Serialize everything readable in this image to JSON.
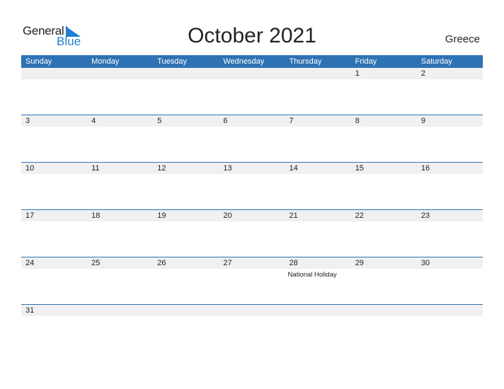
{
  "logo": {
    "line1": "General",
    "line2": "Blue"
  },
  "title": "October 2021",
  "country": "Greece",
  "colors": {
    "accent": "#2e72b3",
    "band": "#f0f0f0",
    "logo_blue": "#1f7fd1"
  },
  "weekdays": [
    "Sunday",
    "Monday",
    "Tuesday",
    "Wednesday",
    "Thursday",
    "Friday",
    "Saturday"
  ],
  "weeks": [
    [
      "",
      "",
      "",
      "",
      "",
      "1",
      "2"
    ],
    [
      "3",
      "4",
      "5",
      "6",
      "7",
      "8",
      "9"
    ],
    [
      "10",
      "11",
      "12",
      "13",
      "14",
      "15",
      "16"
    ],
    [
      "17",
      "18",
      "19",
      "20",
      "21",
      "22",
      "23"
    ],
    [
      "24",
      "25",
      "26",
      "27",
      "28",
      "29",
      "30"
    ],
    [
      "31",
      "",
      "",
      "",
      "",
      "",
      ""
    ]
  ],
  "events": [
    {
      "week": 4,
      "day": 4,
      "label": "National Holiday"
    }
  ]
}
